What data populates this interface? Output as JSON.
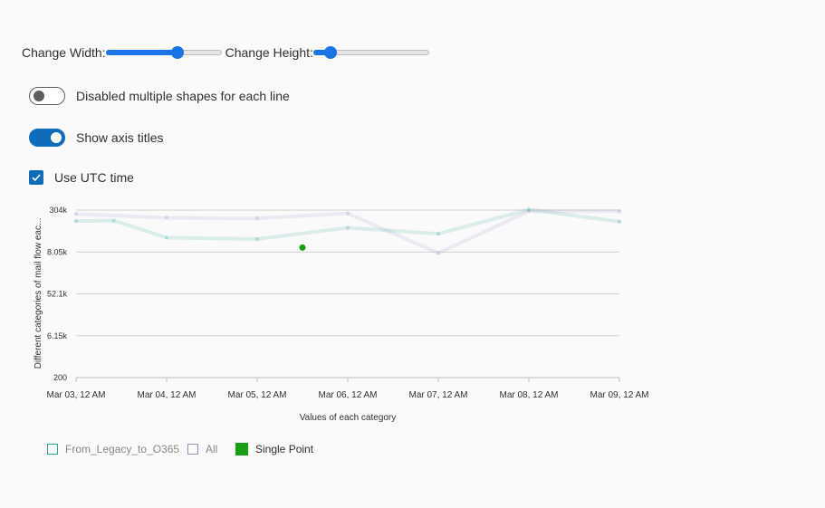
{
  "controls": {
    "width_label": "Change Width:",
    "width_value": 0.62,
    "height_label": "Change Height:",
    "height_value": 0.15,
    "toggle_shapes_label": "Disabled multiple shapes for each line",
    "toggle_shapes_on": false,
    "toggle_axis_label": "Show axis titles",
    "toggle_axis_on": true,
    "utc_label": "Use UTC time",
    "utc_checked": true
  },
  "colors": {
    "accent": "#0f6cbd",
    "slider": "#1a73e8",
    "legacy": "#2aa79b",
    "all": "#9b8fc4",
    "single": "#13a10e"
  },
  "chart_data": {
    "type": "line",
    "xlabel": "Values of each category",
    "ylabel": "Different categories of mail flow eac...",
    "x_ticks": [
      "Mar 03, 12 AM",
      "Mar 04, 12 AM",
      "Mar 05, 12 AM",
      "Mar 06, 12 AM",
      "Mar 07, 12 AM",
      "Mar 08, 12 AM",
      "Mar 09, 12 AM"
    ],
    "y_ticks": [
      "304k",
      "8.05k",
      "52.1k",
      "6.15k",
      "200"
    ],
    "x_range": [
      "2023-03-03T00:00",
      "2023-03-09T00:00"
    ],
    "y_ticks_values": [
      304000,
      228050,
      152100,
      76150,
      200
    ],
    "ylim": [
      200,
      304000
    ],
    "grid": true,
    "legend": "bottom-left",
    "series": [
      {
        "name": "From_Legacy_to_O365",
        "color": "#2aa79b",
        "points": [
          {
            "x": "2023-03-03T00:00",
            "y": 284000
          },
          {
            "x": "2023-03-03T10:00",
            "y": 285000
          },
          {
            "x": "2023-03-04T00:00",
            "y": 254000
          },
          {
            "x": "2023-03-05T00:00",
            "y": 251500
          },
          {
            "x": "2023-03-06T00:00",
            "y": 272000
          },
          {
            "x": "2023-03-07T00:00",
            "y": 261000
          },
          {
            "x": "2023-03-08T00:00",
            "y": 305000
          },
          {
            "x": "2023-03-09T00:00",
            "y": 283000
          }
        ]
      },
      {
        "name": "All",
        "color": "#9b8fc4",
        "points": [
          {
            "x": "2023-03-03T00:00",
            "y": 297000
          },
          {
            "x": "2023-03-04T00:00",
            "y": 290000
          },
          {
            "x": "2023-03-05T00:00",
            "y": 289000
          },
          {
            "x": "2023-03-06T00:00",
            "y": 298000
          },
          {
            "x": "2023-03-07T00:00",
            "y": 226000
          },
          {
            "x": "2023-03-08T00:00",
            "y": 302000
          },
          {
            "x": "2023-03-09T00:00",
            "y": 302000
          }
        ]
      },
      {
        "name": "Single Point",
        "color": "#13a10e",
        "points": [
          {
            "x": "2023-03-05T12:00",
            "y": 236000
          }
        ]
      }
    ]
  }
}
